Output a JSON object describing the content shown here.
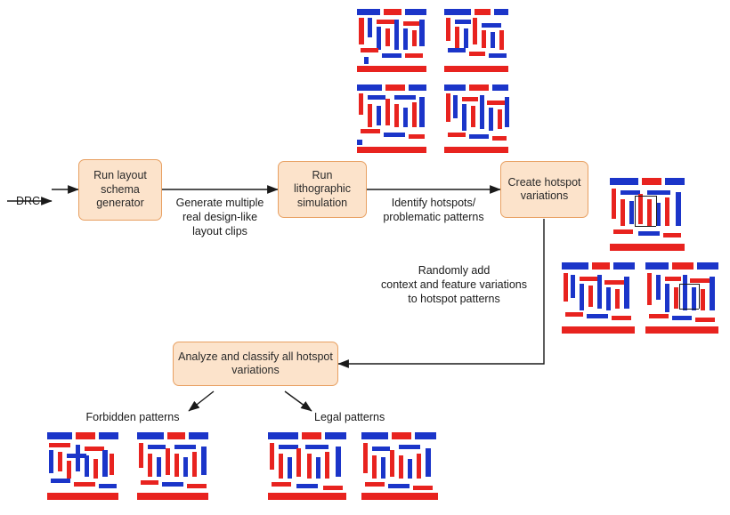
{
  "diagram": {
    "title_nodes": [
      {
        "id": "drc",
        "label": "DRC"
      },
      {
        "id": "rlsg",
        "label": "Run\nlayout\nschema\ngenerator"
      },
      {
        "id": "rls",
        "label": "Run\nlithographic\nsimulation"
      },
      {
        "id": "chv",
        "label": "Create\nhotspot\nvariations"
      },
      {
        "id": "acah",
        "label": "Analyze and classify all\nhotspot variations"
      }
    ],
    "edge_labels": [
      {
        "id": "gen-multiple",
        "text": "Generate multiple\nreal design-like\nlayout clips"
      },
      {
        "id": "identify-hotspots",
        "text": "Identify hotspots/\nproblematic patterns"
      },
      {
        "id": "randomly-add",
        "text": "Randomly add\ncontext and feature variations\nto hotspot patterns"
      },
      {
        "id": "forbidden",
        "text": "Forbidden patterns"
      },
      {
        "id": "legal",
        "text": "Legal patterns"
      }
    ],
    "colors": {
      "box_fill": "#fce3cb",
      "box_border": "#e8a062",
      "text": "#1a1a1a",
      "arrow": "#1a1a1a",
      "clip_red": "#e8231f",
      "clip_blue": "#1b35c9"
    }
  }
}
